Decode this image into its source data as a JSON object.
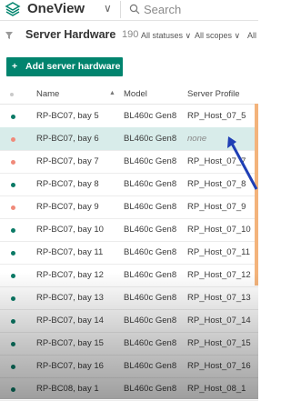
{
  "app": {
    "title": "OneView",
    "search_placeholder": "Search"
  },
  "header": {
    "title": "Server Hardware",
    "count": "190",
    "filters": {
      "status": "All statuses ∨",
      "scope": "All scopes ∨",
      "all": "All"
    }
  },
  "actions": {
    "add_label": "Add server hardware",
    "add_icon": "+"
  },
  "table": {
    "headers": {
      "name": "Name",
      "model": "Model",
      "profile": "Server Profile"
    },
    "rows": [
      {
        "name": "RP-BC07, bay 5",
        "model": "BL460c Gen8",
        "profile": "RP_Host_07_5",
        "status": "ok",
        "selected": false
      },
      {
        "name": "RP-BC07, bay 6",
        "model": "BL460c Gen8",
        "profile": "none",
        "status": "disabled",
        "selected": true
      },
      {
        "name": "RP-BC07, bay 7",
        "model": "BL460c Gen8",
        "profile": "RP_Host_07_7",
        "status": "disabled",
        "selected": false
      },
      {
        "name": "RP-BC07, bay 8",
        "model": "BL460c Gen8",
        "profile": "RP_Host_07_8",
        "status": "ok",
        "selected": false
      },
      {
        "name": "RP-BC07, bay 9",
        "model": "BL460c Gen8",
        "profile": "RP_Host_07_9",
        "status": "disabled",
        "selected": false
      },
      {
        "name": "RP-BC07, bay 10",
        "model": "BL460c Gen8",
        "profile": "RP_Host_07_10",
        "status": "ok",
        "selected": false
      },
      {
        "name": "RP-BC07, bay 11",
        "model": "BL460c Gen8",
        "profile": "RP_Host_07_11",
        "status": "ok",
        "selected": false
      },
      {
        "name": "RP-BC07, bay 12",
        "model": "BL460c Gen8",
        "profile": "RP_Host_07_12",
        "status": "ok",
        "selected": false
      },
      {
        "name": "RP-BC07, bay 13",
        "model": "BL460c Gen8",
        "profile": "RP_Host_07_13",
        "status": "ok",
        "selected": false
      },
      {
        "name": "RP-BC07, bay 14",
        "model": "BL460c Gen8",
        "profile": "RP_Host_07_14",
        "status": "ok",
        "selected": false
      },
      {
        "name": "RP-BC07, bay 15",
        "model": "BL460c Gen8",
        "profile": "RP_Host_07_15",
        "status": "ok",
        "selected": false
      },
      {
        "name": "RP-BC07, bay 16",
        "model": "BL460c Gen8",
        "profile": "RP_Host_07_16",
        "status": "ok",
        "selected": false
      },
      {
        "name": "RP-BC08, bay 1",
        "model": "BL460c Gen8",
        "profile": "RP_Host_08_1",
        "status": "ok",
        "selected": false
      }
    ]
  },
  "colors": {
    "accent": "#01846e",
    "status_ok": "#0b7a66",
    "status_disabled": "#f08a7a",
    "selected_row": "#d8ecea",
    "annotation": "#1f3fb5"
  },
  "icons": {
    "logo": "oneview-logo-icon",
    "chevron": "chevron-down-icon",
    "search": "search-icon",
    "filter": "filter-icon",
    "sort": "sort-arrow-icon",
    "annotation": "pointer-arrow-icon"
  }
}
